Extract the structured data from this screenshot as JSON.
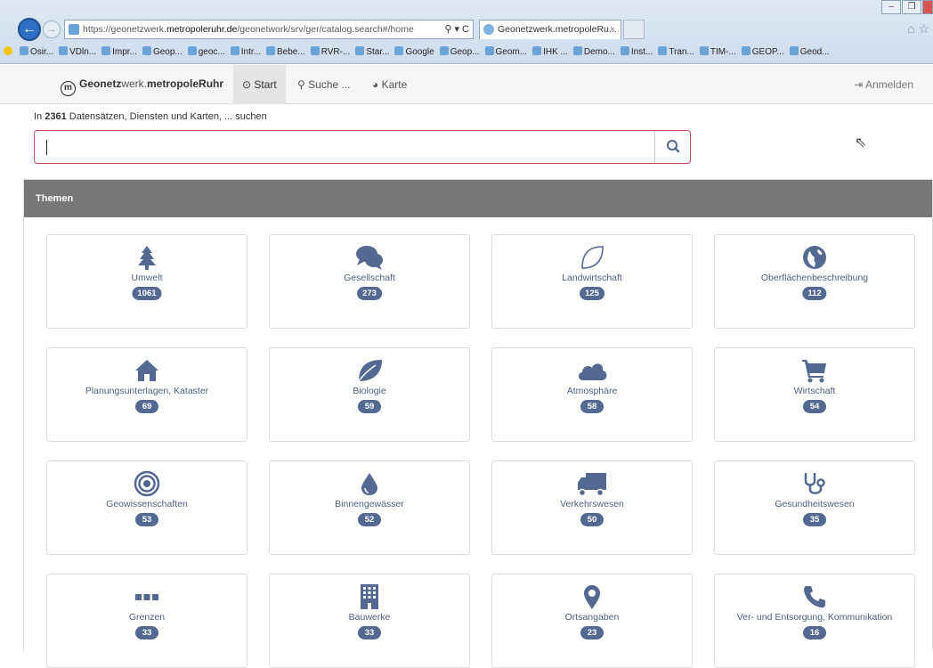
{
  "browser": {
    "url_prefix": "https://geonetzwerk.",
    "url_domain": "metropoleruhr.de",
    "url_path": "/geonetwork/srv/ger/catalog.search#/home",
    "tab_title": "Geonetzwerk.metropoleRu...",
    "tab_close": "×",
    "address_controls": "⚲ ▾ C",
    "favorites": [
      "Osir...",
      "VDln...",
      "Impr...",
      "Geop...",
      "geoc...",
      "Intr...",
      "Bebe...",
      "RVR-...",
      "Star...",
      "Google",
      "Geop...",
      "Geom...",
      "IHK ...",
      "Demo...",
      "Inst...",
      "Tran...",
      "TIM-...",
      "GEOP...",
      "Geod..."
    ]
  },
  "nav": {
    "brand_strong": "Geonetz",
    "brand_light": "werk.",
    "brand_rest": "metropoleRuhr",
    "start": "Start",
    "search": "Suche ...",
    "map": "Karte",
    "login": "Anmelden"
  },
  "search": {
    "prefix": "In ",
    "count": "2361",
    "suffix": " Datensätzen, Diensten und Karten, ... suchen",
    "value": ""
  },
  "panel": {
    "title": "Themen"
  },
  "topics": [
    {
      "label": "Umwelt",
      "count": "1061",
      "icon": "tree-icon"
    },
    {
      "label": "Gesellschaft",
      "count": "273",
      "icon": "comments-icon"
    },
    {
      "label": "Landwirtschaft",
      "count": "125",
      "icon": "leaf-outline-icon"
    },
    {
      "label": "Oberflächenbeschreibung",
      "count": "112",
      "icon": "globe-icon"
    },
    {
      "label": "Planungsunterlagen, Kataster",
      "count": "69",
      "icon": "home-icon"
    },
    {
      "label": "Biologie",
      "count": "59",
      "icon": "leaf-icon"
    },
    {
      "label": "Atmosphäre",
      "count": "58",
      "icon": "cloud-icon"
    },
    {
      "label": "Wirtschaft",
      "count": "54",
      "icon": "cart-icon"
    },
    {
      "label": "Geowissenschaften",
      "count": "53",
      "icon": "bullseye-icon"
    },
    {
      "label": "Binnengewässer",
      "count": "52",
      "icon": "drop-icon"
    },
    {
      "label": "Verkehrswesen",
      "count": "50",
      "icon": "truck-icon"
    },
    {
      "label": "Gesundheitswesen",
      "count": "35",
      "icon": "stethoscope-icon"
    },
    {
      "label": "Grenzen",
      "count": "33",
      "icon": "ellipsis-icon"
    },
    {
      "label": "Bauwerke",
      "count": "33",
      "icon": "building-icon"
    },
    {
      "label": "Ortsangaben",
      "count": "23",
      "icon": "map-marker-icon"
    },
    {
      "label": "Ver- und Entsorgung, Kommunikation",
      "count": "16",
      "icon": "phone-icon"
    }
  ],
  "colors": {
    "accent": "#536991",
    "search_border": "#c9485b",
    "panel_head": "#777777"
  }
}
